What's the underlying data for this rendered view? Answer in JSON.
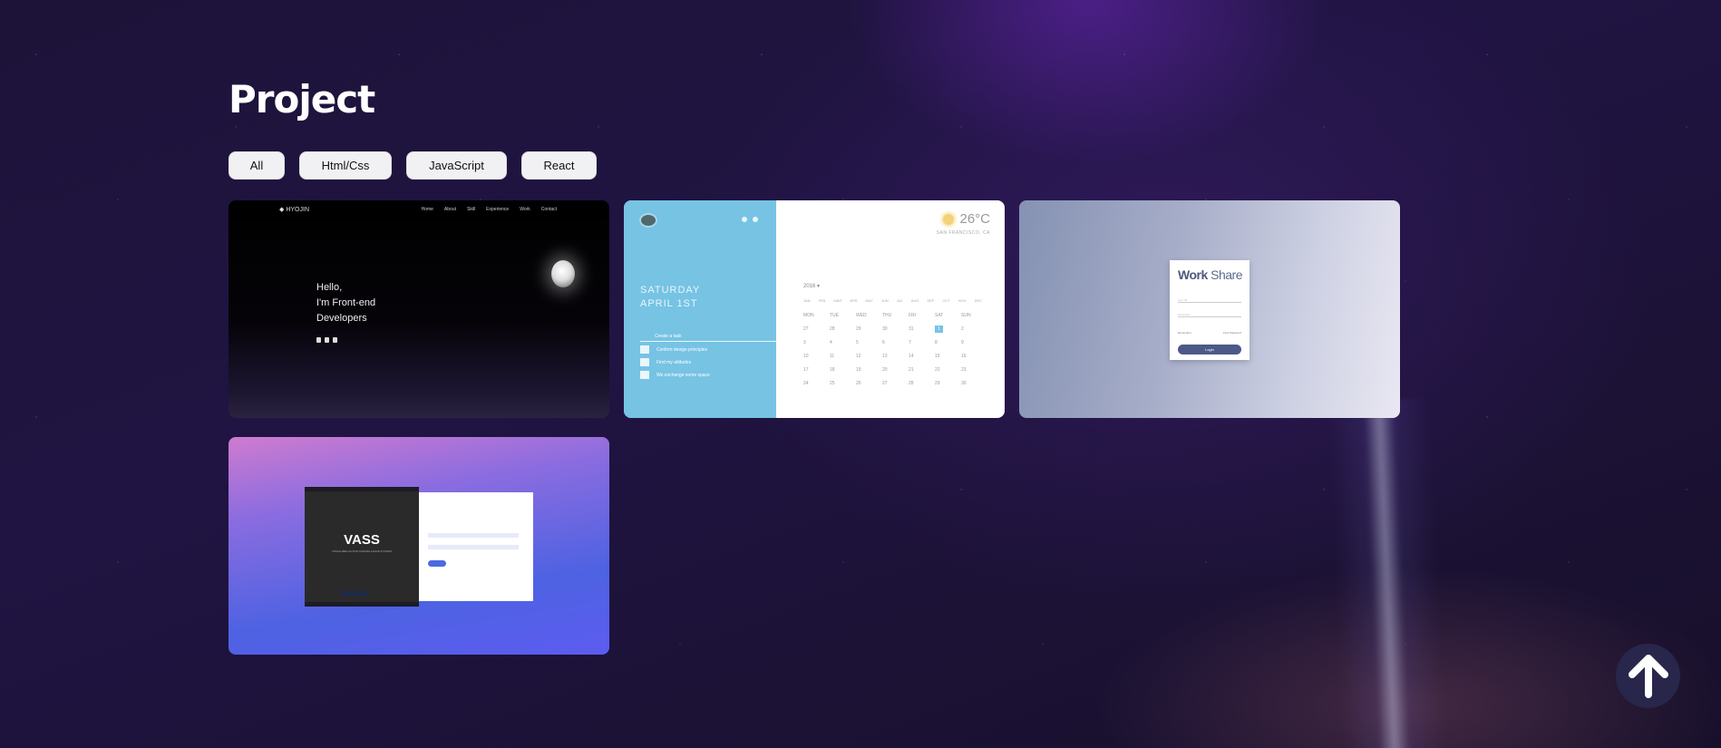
{
  "page": {
    "title": "Project"
  },
  "filters": [
    {
      "label": "All"
    },
    {
      "label": "Html/Css"
    },
    {
      "label": "JavaScript"
    },
    {
      "label": "React"
    }
  ],
  "projects": [
    {
      "preview": {
        "logo": "HYOJIN",
        "nav": [
          "Home",
          "About",
          "Skill",
          "Experience",
          "Work",
          "Contact"
        ],
        "hero_line1": "Hello,",
        "hero_line2": "I'm Front-end",
        "hero_line3": "Developers"
      }
    },
    {
      "preview": {
        "day": "SATURDAY",
        "date": "APRIL 1ST",
        "task_header": "Create a task",
        "tasks": [
          "Confirm design principles",
          "Find my attitudes",
          "We exchange some space"
        ],
        "temperature": "26°C",
        "city": "SAN FRANCISCO, CA",
        "year": "2016 ▾",
        "months": [
          "JAN",
          "FEB",
          "MAR",
          "APR",
          "MAY",
          "JUN",
          "JUL",
          "AUG",
          "SEP",
          "OCT",
          "NOV",
          "DEC"
        ],
        "weekdays": [
          "MON",
          "TUE",
          "WED",
          "THU",
          "FRI",
          "SAT",
          "SUN"
        ],
        "days": [
          "27",
          "28",
          "29",
          "30",
          "31",
          "1",
          "2",
          "3",
          "4",
          "5",
          "6",
          "7",
          "8",
          "9",
          "10",
          "11",
          "12",
          "13",
          "14",
          "15",
          "16",
          "17",
          "18",
          "19",
          "20",
          "21",
          "22",
          "23",
          "24",
          "25",
          "26",
          "27",
          "28",
          "29",
          "30"
        ]
      }
    },
    {
      "preview": {
        "brand_bold": "Work",
        "brand_rest": "Share",
        "id_placeholder": "User ID",
        "pw_placeholder": "Password",
        "remember": "Remember",
        "find": "Find Password",
        "login": "Login"
      }
    },
    {
      "preview": {
        "title": "VASS",
        "subtitle": "VISUALIZED ACTIVE SURVEILLANCE SYSTEM"
      }
    }
  ],
  "scroll_top": {
    "icon": "arrow-up-icon"
  }
}
